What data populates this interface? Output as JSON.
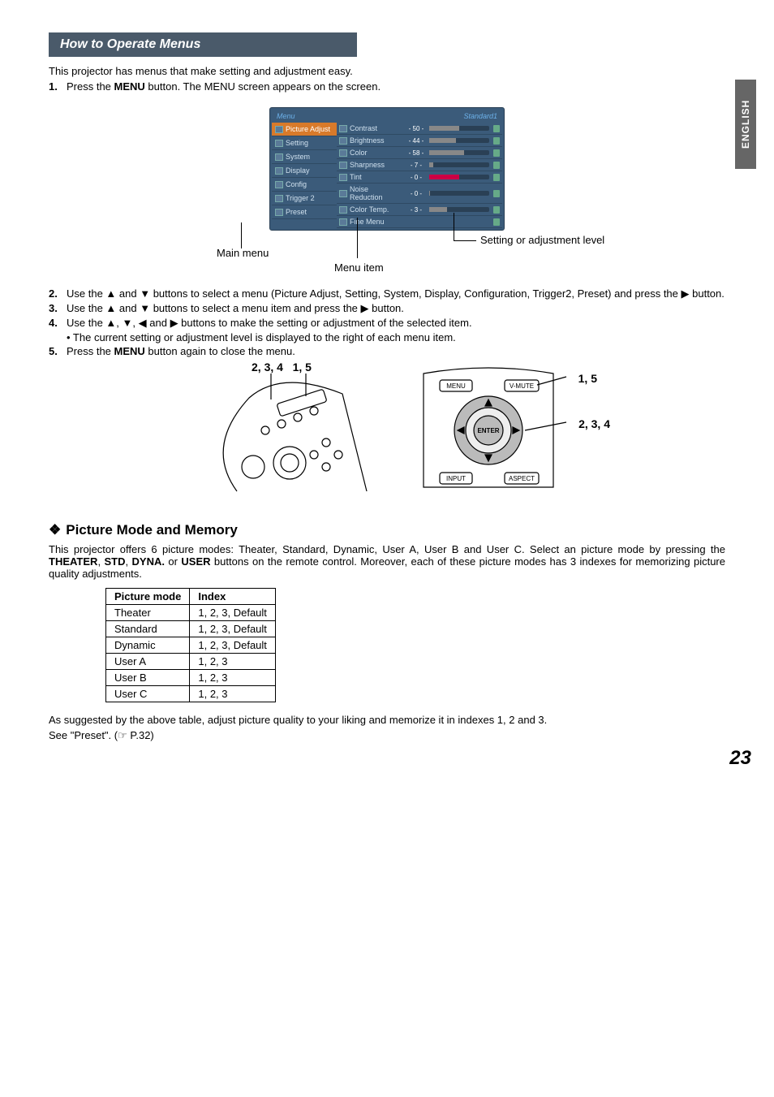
{
  "sideTab": "ENGLISH",
  "header": "How to Operate Menus",
  "intro": "This projector has menus that make setting and adjustment easy.",
  "steps": {
    "s1_a": "Press the ",
    "s1_b": "MENU",
    "s1_c": " button. The MENU screen appears on the screen.",
    "s2_a": "Use the ",
    "s2_b": " and ",
    "s2_c": " buttons to select a menu (Picture Adjust, Setting, System, Display, Configuration, Trigger2, Preset) and press the ",
    "s2_d": " button.",
    "s3_a": "Use the ",
    "s3_b": " and ",
    "s3_c": " buttons to select a menu item and press the ",
    "s3_d": " button.",
    "s4_a": "Use the ",
    "s4_b": ", ",
    "s4_c": ", ",
    "s4_d": " and ",
    "s4_e": " buttons to make the setting or adjustment of the selected item.",
    "s4_sub": "• The current setting or adjustment level is displayed to the right of each menu item.",
    "s5_a": "Press the ",
    "s5_b": "MENU",
    "s5_c": " button again to close the menu."
  },
  "osd": {
    "title": "Menu",
    "preset": "Standard1",
    "sidebar": [
      "Picture Adjust",
      "Setting",
      "System",
      "Display",
      "Config",
      "Trigger 2",
      "Preset"
    ],
    "items": [
      {
        "label": "Contrast",
        "val": "- 50 -"
      },
      {
        "label": "Brightness",
        "val": "- 44 -"
      },
      {
        "label": "Color",
        "val": "- 58 -"
      },
      {
        "label": "Sharpness",
        "val": "- 7 -"
      },
      {
        "label": "Tint",
        "val": "- 0 -"
      },
      {
        "label": "Noise Reduction",
        "val": "- 0 -"
      },
      {
        "label": "Color Temp.",
        "val": "- 3 -"
      },
      {
        "label": "Fine Menu",
        "val": ""
      }
    ],
    "callouts": {
      "main": "Main menu",
      "item": "Menu item",
      "level": "Setting or adjustment level"
    }
  },
  "figLabels": {
    "remote_left": "2, 3, 4",
    "remote_right": "1, 5",
    "panel_top": "1, 5",
    "panel_mid": "2, 3, 4"
  },
  "panelButtons": {
    "menu": "MENU",
    "vmute": "V-MUTE",
    "enter": "ENTER",
    "input": "INPUT",
    "aspect": "ASPECT"
  },
  "picModeHeading": "Picture Mode and Memory",
  "picModePara_a": "This projector offers 6 picture modes: Theater, Standard, Dynamic, User A, User B and User C. Select an picture mode by pressing the ",
  "picModePara_b": "THEATER",
  "picModePara_c": ", ",
  "picModePara_d": "STD",
  "picModePara_e": ", ",
  "picModePara_f": "DYNA.",
  "picModePara_g": " or ",
  "picModePara_h": "USER",
  "picModePara_i": " buttons on the remote control. Moreover, each of these picture modes has 3 indexes for memorizing picture quality adjustments.",
  "tableHead": {
    "mode": "Picture mode",
    "index": "Index"
  },
  "tableRows": [
    {
      "mode": "Theater",
      "index": "1, 2, 3, Default"
    },
    {
      "mode": "Standard",
      "index": "1, 2, 3, Default"
    },
    {
      "mode": "Dynamic",
      "index": "1, 2, 3, Default"
    },
    {
      "mode": "User A",
      "index": "1, 2, 3"
    },
    {
      "mode": "User B",
      "index": "1, 2, 3"
    },
    {
      "mode": "User C",
      "index": "1, 2, 3"
    }
  ],
  "afterTable1": "As suggested by the above table, adjust picture quality to your liking and memorize it in indexes 1, 2 and 3.",
  "afterTable2": "See \"Preset\". (☞ P.32)",
  "pageNumber": "23"
}
